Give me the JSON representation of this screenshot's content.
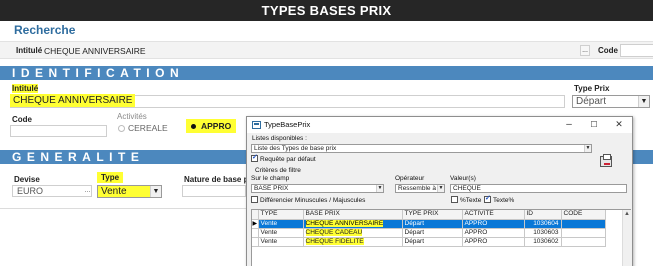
{
  "page": {
    "title": "TYPES BASES PRIX"
  },
  "recherche": {
    "title": "Recherche",
    "intitule_label": "Intitulé",
    "intitule_value": "CHEQUE ANNIVERSAIRE",
    "ellipsis": "...",
    "code_label": "Code"
  },
  "identification": {
    "section_title": "IDENTIFICATION",
    "intitule_label": "Intitulé",
    "intitule_value": "CHEQUE ANNIVERSAIRE",
    "type_prix_label": "Type Prix",
    "type_prix_value": "Départ",
    "code_label": "Code",
    "activites_label": "Activités",
    "activities": [
      {
        "label": "CEREALE",
        "selected": false
      },
      {
        "label": "APPRO",
        "selected": true
      }
    ]
  },
  "generalite": {
    "section_title": "GENERALITE",
    "devise_label": "Devise",
    "devise_value": "EURO",
    "devise_ellipsis": "...",
    "type_label": "Type",
    "type_value": "Vente",
    "nature_label": "Nature de base pris"
  },
  "dialog": {
    "title": "TypeBasePrix",
    "controls": {
      "minimize": "–",
      "maximize": "☐",
      "close": "✕"
    },
    "listes_label": "Listes disponibles :",
    "liste_value": "Liste des Types de base prix",
    "requete_label": "Requête par défaut",
    "requete_checked": true,
    "criteres_label": "Critères de filtre",
    "sur_champ_label": "Sur le champ",
    "sur_champ_value": "BASE PRIX",
    "operateur_label": "Opérateur",
    "operateur_value": "Ressemble à",
    "valeurs_label": "Valeur(s)",
    "valeurs_value": "CHEQUE",
    "differencier_label": "Différencier Minuscules / Majuscules",
    "differencier_checked": false,
    "texte1_label": "%Texte",
    "texte1_checked": false,
    "texte2_label": "Texte%",
    "texte2_checked": true,
    "columns": [
      "TYPE",
      "BASE PRIX",
      "TYPE PRIX",
      "ACTIVITE",
      "ID",
      "CODE"
    ],
    "rows": [
      {
        "indicator": "▶",
        "type": "Vente",
        "base_prix": "CHEQUE ANNIVERSAIRE",
        "type_prix": "Départ",
        "activite": "APPRO",
        "id": "1030604",
        "code": ""
      },
      {
        "indicator": "",
        "type": "Vente",
        "base_prix": "CHEQUE CADEAU",
        "type_prix": "Départ",
        "activite": "APPRO",
        "id": "1030603",
        "code": ""
      },
      {
        "indicator": "",
        "type": "Vente",
        "base_prix": "CHEQUE FIDELITE",
        "type_prix": "Départ",
        "activite": "APPRO",
        "id": "1030602",
        "code": ""
      }
    ]
  },
  "colors": {
    "section_bar": "#4c88be",
    "title_bar": "#262626",
    "highlight": "#ffff33",
    "selection": "#0a78d7"
  },
  "icons": [
    "app-window-icon",
    "print-icon",
    "lightning-icon",
    "chevron-down-icon",
    "scroll-up-icon"
  ]
}
